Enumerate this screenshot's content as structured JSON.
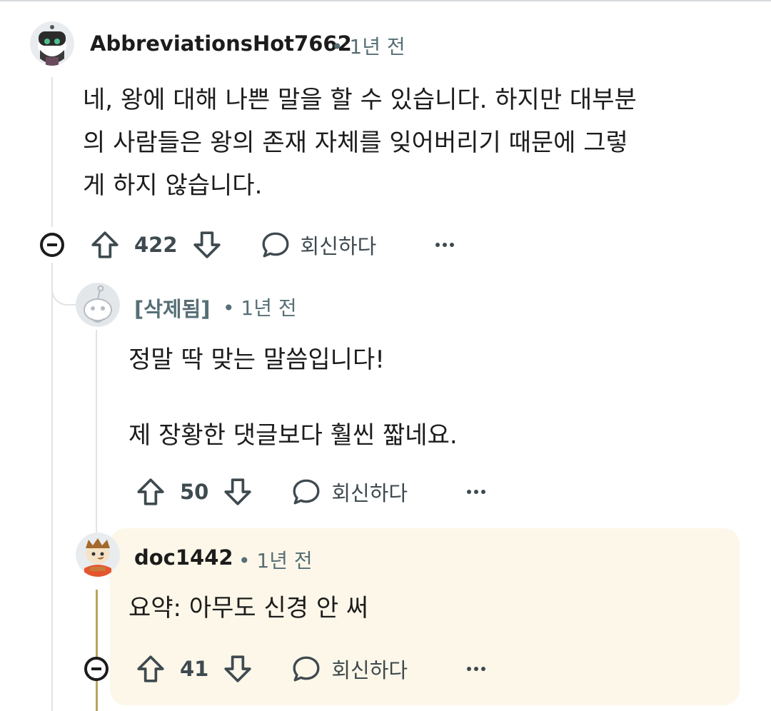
{
  "comments": [
    {
      "username": "AbbreviationsHot7662",
      "age": "• 1년 전",
      "body": [
        "네, 왕에 대해 나쁜 말을 할 수 있습니다. 하지만 대부분",
        "의 사람들은 왕의 존재 자체를 잊어버리기 때문에 그렇",
        "게 하지 않습니다."
      ],
      "votes": "422",
      "reply_label": "회신하다"
    },
    {
      "username": "[삭제됨]",
      "age": "• 1년 전",
      "body": [
        "정말 딱 맞는 말씀입니다!",
        "제 장황한 댓글보다 훨씬 짧네요."
      ],
      "votes": "50",
      "reply_label": "회신하다"
    },
    {
      "username": "doc1442",
      "age": "• 1년 전",
      "body": [
        "요약: 아무도 신경 안 써"
      ],
      "votes": "41",
      "reply_label": "회신하다"
    }
  ],
  "colors": {
    "highlight_background": "#fcf7e9",
    "thread_line": "#e1e3e5",
    "highlight_line": "#b9a35d",
    "meta_text": "#576f76"
  },
  "icons": [
    "upvote-icon",
    "downvote-icon",
    "comment-icon",
    "more-icon",
    "collapse-icon"
  ]
}
